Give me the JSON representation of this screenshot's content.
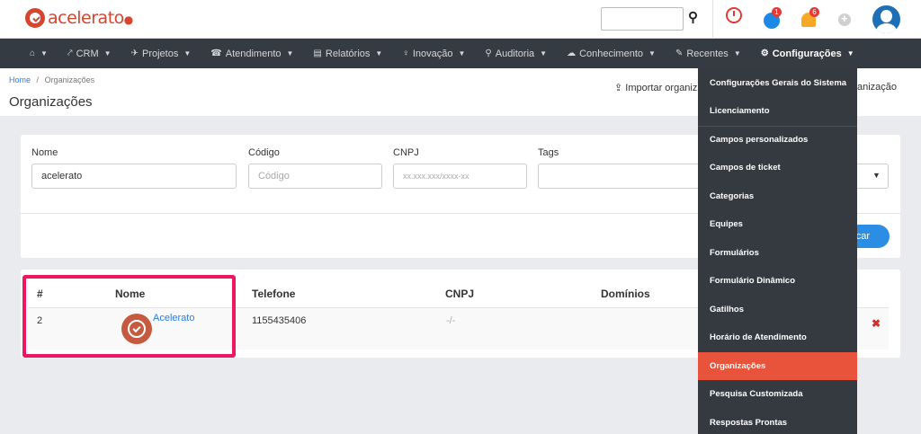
{
  "header": {
    "logo_text": "acelerato",
    "logo_dot": "●",
    "search_icon": "magnifier-icon",
    "notifications": {
      "globe_badge": "1",
      "bell_badge": "6"
    },
    "icons": [
      "timer-icon",
      "globe-icon",
      "bell-icon",
      "plus-circle-icon",
      "avatar"
    ]
  },
  "nav": {
    "items": [
      {
        "icon": "⌂",
        "label": ""
      },
      {
        "icon": "⤤",
        "label": "CRM"
      },
      {
        "icon": "✈",
        "label": "Projetos"
      },
      {
        "icon": "☎",
        "label": "Atendimento"
      },
      {
        "icon": "▤",
        "label": "Relatórios"
      },
      {
        "icon": "♀",
        "label": "Inovação"
      },
      {
        "icon": "⚲",
        "label": "Auditoria"
      },
      {
        "icon": "☁",
        "label": "Conhecimento"
      },
      {
        "icon": "✎",
        "label": "Recentes"
      },
      {
        "icon": "⚙",
        "label": "Configurações"
      }
    ]
  },
  "breadcrumb": {
    "home": "Home",
    "separator": "/",
    "current": "Organizações"
  },
  "page_title": "Organizações",
  "actions": {
    "import": "Importar organiza",
    "new_org_tail": "anização"
  },
  "filters": {
    "nome": {
      "label": "Nome",
      "value": "acelerato"
    },
    "codigo": {
      "label": "Código",
      "placeholder": "Código"
    },
    "cnpj": {
      "label": "CNPJ",
      "placeholder": "xx.xxx.xxx/xxxx-xx"
    },
    "tags": {
      "label": "Tags"
    },
    "search_button": "scar"
  },
  "table": {
    "headers": {
      "num": "#",
      "nome": "Nome",
      "telefone": "Telefone",
      "cnpj": "CNPJ",
      "dominios": "Domínios"
    },
    "rows": [
      {
        "num": "2",
        "nome": "Acelerato",
        "telefone": "1155435406",
        "cnpj": "-/-"
      }
    ]
  },
  "dropdown": {
    "items": [
      "Configurações Gerais do Sistema",
      "Licenciamento",
      "Campos personalizados",
      "Campos de ticket",
      "Categorias",
      "Equipes",
      "Formulários",
      "Formulário Dinâmico",
      "Gatilhos",
      "Horário de Atendimento",
      "Organizações",
      "Pesquisa Customizada",
      "Respostas Prontas"
    ],
    "active": "Organizações"
  },
  "colors": {
    "brand": "#d6452f",
    "nav_bg": "#353b42",
    "accent": "#2b8de3",
    "active_menu": "#e8533b",
    "highlight": "#ee1762"
  }
}
